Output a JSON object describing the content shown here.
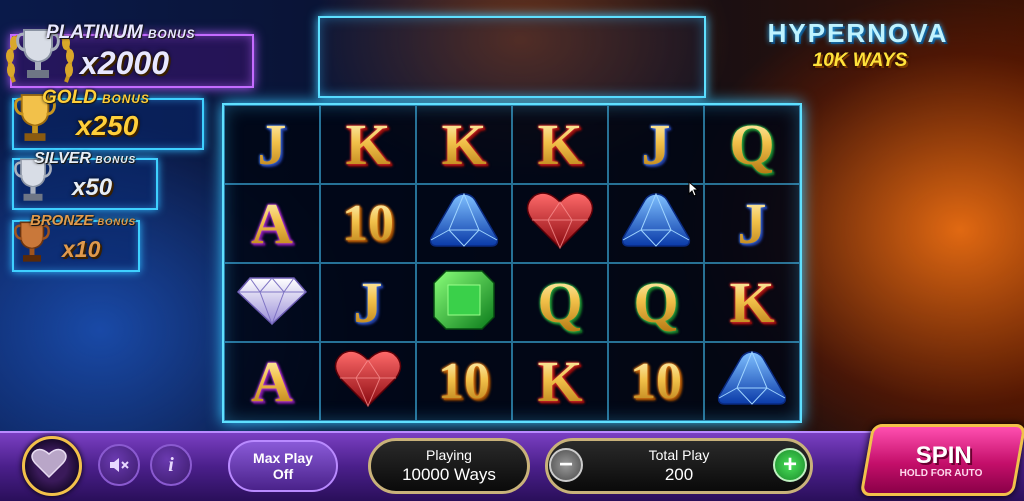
{
  "bonuses": {
    "platinum": {
      "title": "PLATINUM",
      "suffix": "BONUS",
      "multiplier": "x2000"
    },
    "gold": {
      "title": "GOLD",
      "suffix": "BONUS",
      "multiplier": "x250"
    },
    "silver": {
      "title": "SILVER",
      "suffix": "BONUS",
      "multiplier": "x50"
    },
    "bronze": {
      "title": "BRONZE",
      "suffix": "BONUS",
      "multiplier": "x10"
    }
  },
  "logo": {
    "title": "HYPERNOVA",
    "subtitle": "10K WAYS"
  },
  "reels": [
    [
      {
        "t": "text",
        "v": "J",
        "c": "blue"
      },
      {
        "t": "text",
        "v": "A",
        "c": "purple"
      },
      {
        "t": "gem",
        "v": "diamond"
      },
      {
        "t": "text",
        "v": "A",
        "c": "purple"
      }
    ],
    [
      {
        "t": "text",
        "v": "K",
        "c": "red"
      },
      {
        "t": "text",
        "v": "10",
        "c": "orange"
      },
      {
        "t": "text",
        "v": "J",
        "c": "blue"
      },
      {
        "t": "gem",
        "v": "heart"
      }
    ],
    [
      {
        "t": "text",
        "v": "K",
        "c": "red"
      },
      {
        "t": "gem",
        "v": "sapphire"
      },
      {
        "t": "gem",
        "v": "emerald"
      },
      {
        "t": "text",
        "v": "10",
        "c": "orange"
      }
    ],
    [
      {
        "t": "text",
        "v": "K",
        "c": "red"
      },
      {
        "t": "gem",
        "v": "heart"
      },
      {
        "t": "text",
        "v": "Q",
        "c": "green"
      },
      {
        "t": "text",
        "v": "K",
        "c": "red"
      }
    ],
    [
      {
        "t": "text",
        "v": "J",
        "c": "blue"
      },
      {
        "t": "gem",
        "v": "sapphire"
      },
      {
        "t": "text",
        "v": "Q",
        "c": "green"
      },
      {
        "t": "text",
        "v": "10",
        "c": "orange"
      }
    ],
    [
      {
        "t": "text",
        "v": "Q",
        "c": "green"
      },
      {
        "t": "text",
        "v": "J",
        "c": "blue"
      },
      {
        "t": "text",
        "v": "K",
        "c": "red"
      },
      {
        "t": "gem",
        "v": "sapphire"
      }
    ]
  ],
  "controls": {
    "max_play": {
      "line1": "Max Play",
      "line2": "Off"
    },
    "playing": {
      "label": "Playing",
      "value": "10000 Ways"
    },
    "total_play": {
      "label": "Total Play",
      "value": "200"
    },
    "minus": "−",
    "plus": "+",
    "info": "i",
    "spin": {
      "label": "SPIN",
      "sub": "HOLD FOR AUTO"
    }
  },
  "icons": [
    "trophy-icon",
    "laurel-icon",
    "heart-icon",
    "mute-icon",
    "info-icon",
    "cursor-icon"
  ],
  "colors": {
    "accent_cyan": "#5fe0ff",
    "bar_purple": "#4a1f8a",
    "spin_pink": "#e0187a",
    "gold": "#f2c14a"
  }
}
